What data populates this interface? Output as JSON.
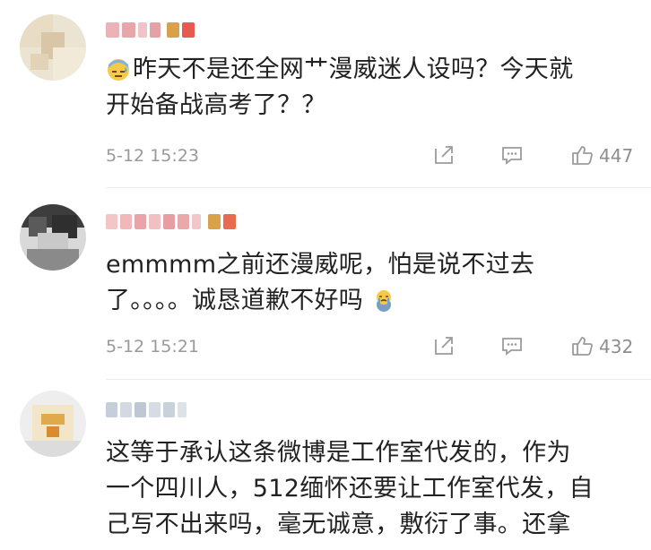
{
  "comments": [
    {
      "lines": [
        "昨天不是还全网艹漫威迷人设吗？今天就",
        "开始备战高考了？？"
      ],
      "time": "5-12 15:23",
      "likes": "447",
      "leading_emoji": "sweat-face-emoji"
    },
    {
      "lines": [
        "emmmm之前还漫威呢，怕是说不过去",
        "了。。。。诚恳道歉不好吗"
      ],
      "time": "5-12 15:21",
      "likes": "432",
      "trailing_emoji": "crying-face-emoji"
    },
    {
      "lines": [
        "这等于承认这条微博是工作室代发的，作为",
        "一个四川人，512缅怀还要让工作室代发，自",
        "己写不出来吗，毫无诚意，敷衍了事。还拿"
      ]
    }
  ],
  "icons": {
    "forward": "forward-icon",
    "comment": "comment-icon",
    "like": "thumbs-up-icon"
  },
  "colors": {
    "text": "#222222",
    "meta": "#9a9a9a",
    "icon": "#9b9b9b"
  }
}
